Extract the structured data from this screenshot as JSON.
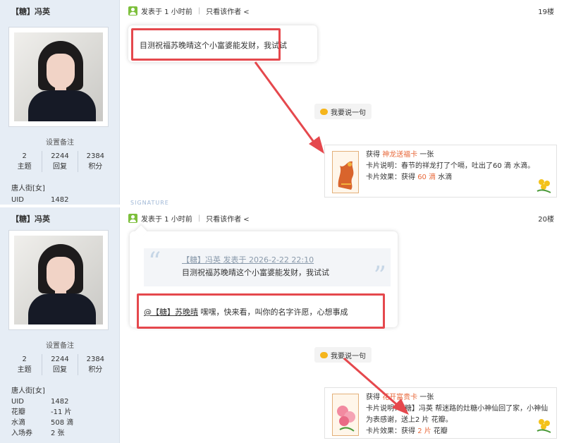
{
  "colors": {
    "accent_red": "#e5484d",
    "highlight": "#e8693b",
    "sidebar_bg": "#e6edf5"
  },
  "posts": [
    {
      "author": "【糖】冯英",
      "set_note": "设置备注",
      "stats": [
        {
          "value": "2",
          "label": "主题"
        },
        {
          "value": "2244",
          "label": "回复"
        },
        {
          "value": "2384",
          "label": "积分"
        }
      ],
      "group": "唐人街[女]",
      "info": [
        {
          "k": "UID",
          "v": "1482"
        }
      ],
      "posted_ago": "发表于 1 小时前",
      "only_author": "只看该作者 <",
      "floor": "19楼",
      "content": "目测祝福苏晚晴这个小富婆能发财，我试试",
      "say_button": "我要说一句",
      "card": {
        "gain_prefix": "获得 ",
        "card_name": "神龙送福卡",
        "gain_suffix": " 一张",
        "desc": "卡片说明：春节的祥龙打了个嗝，吐出了60 滴 水滴。",
        "effect_prefix": "卡片效果：获得 ",
        "effect_amount": "60 滴",
        "effect_suffix": " 水滴"
      }
    },
    {
      "author": "【糖】冯英",
      "set_note": "设置备注",
      "stats": [
        {
          "value": "2",
          "label": "主题"
        },
        {
          "value": "2244",
          "label": "回复"
        },
        {
          "value": "2384",
          "label": "积分"
        }
      ],
      "group": "唐人街[女]",
      "info": [
        {
          "k": "UID",
          "v": "1482"
        },
        {
          "k": "花瓣",
          "v": "-11 片"
        },
        {
          "k": "水滴",
          "v": "508 滴"
        },
        {
          "k": "入场券",
          "v": "2 张"
        }
      ],
      "posted_ago": "发表于 1 小时前",
      "only_author": "只看该作者 <",
      "floor": "20楼",
      "quote_header": "【糖】冯英 发表于 2026-2-22 22:10",
      "quote_text": "目测祝福苏晚晴这个小富婆能发财，我试试",
      "mention": "@【糖】苏晚晴",
      "reply_text": " 嘿嘿，快来看，叫你的名字许愿，心想事成",
      "say_button": "我要说一句",
      "card": {
        "gain_prefix": "获得 ",
        "card_name": "花开富贵卡",
        "gain_suffix": " 一张",
        "desc1": "卡片说明：【糖】冯英 帮迷路的灶糖小神仙回了家，小神仙",
        "desc2": "为表感谢，送上2 片 花瓣。",
        "effect_prefix": "卡片效果：获得 ",
        "effect_amount": "2 片",
        "effect_suffix": " 花瓣"
      }
    }
  ],
  "signature_mark": "SIGNATURE"
}
